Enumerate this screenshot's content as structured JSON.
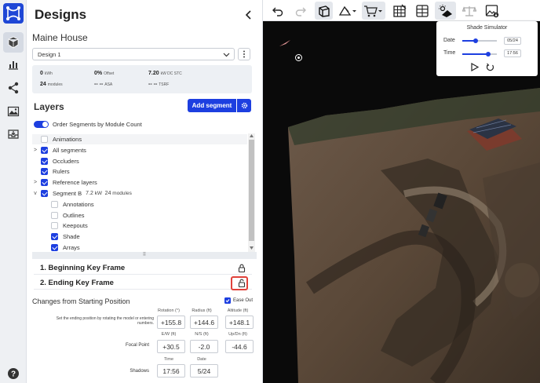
{
  "app": {
    "panel_title": "Designs"
  },
  "project": {
    "name": "Maine House",
    "design_selected": "Design 1"
  },
  "stats": {
    "energy_value": "0",
    "energy_unit": "kWh",
    "offset_value": "0%",
    "offset_unit": "Offset",
    "size_value": "7.20",
    "size_unit": "kW DC STC",
    "modules_value": "24",
    "modules_unit": "modules",
    "asa_value": "-- --",
    "asa_unit": "ASA",
    "tsrf_value": "-- --",
    "tsrf_unit": "TSRF"
  },
  "layers": {
    "heading": "Layers",
    "add_segment_label": "Add segment",
    "order_toggle_label": "Order Segments by Module Count",
    "order_toggle_on": true,
    "rows": [
      {
        "label": "Animations",
        "checked": false,
        "indent": 0,
        "twisty": ""
      },
      {
        "label": "All segments",
        "checked": true,
        "indent": 0,
        "twisty": ">"
      },
      {
        "label": "Occluders",
        "checked": true,
        "indent": 0,
        "twisty": ""
      },
      {
        "label": "Rulers",
        "checked": true,
        "indent": 0,
        "twisty": ""
      },
      {
        "label": "Reference layers",
        "checked": true,
        "indent": 0,
        "twisty": ">"
      },
      {
        "label": "Segment B",
        "checked": true,
        "indent": 0,
        "twisty": "v",
        "size": "7.2",
        "size_unit": "kW",
        "modules": "24",
        "modules_unit": "modules"
      },
      {
        "label": "Annotations",
        "checked": false,
        "indent": 1,
        "twisty": ""
      },
      {
        "label": "Outlines",
        "checked": false,
        "indent": 1,
        "twisty": ""
      },
      {
        "label": "Keepouts",
        "checked": false,
        "indent": 1,
        "twisty": ""
      },
      {
        "label": "Shade",
        "checked": true,
        "indent": 1,
        "twisty": ""
      },
      {
        "label": "Arrays",
        "checked": true,
        "indent": 1,
        "twisty": ""
      }
    ]
  },
  "keyframes": {
    "beginning": "1. Beginning Key Frame",
    "ending": "2. Ending Key Frame"
  },
  "changes": {
    "heading": "Changes from Starting Position",
    "ease_out_label": "Ease Out",
    "ease_out_checked": true,
    "hint": "Set the ending position by rotating the model or entering numbers.",
    "col_rotation": "Rotation (°)",
    "col_radius": "Radius (ft)",
    "col_altitude": "Altitude (ft)",
    "rotation": "+155.8",
    "radius": "+144.6",
    "altitude": "+148.1",
    "col_ew": "E/W (ft)",
    "col_ns": "N/S (ft)",
    "col_updn": "Up/Dn (ft)",
    "focal_label": "Focal Point",
    "ew": "+30.5",
    "ns": "-2.0",
    "updn": "-44.6",
    "col_time": "Time",
    "col_date": "Date",
    "shadows_label": "Shadows",
    "time": "17:56",
    "date": "5/24"
  },
  "shade_sim": {
    "title": "Shade Simulator",
    "date_label": "Date",
    "date_value": "05/24",
    "date_fraction": 0.39,
    "time_label": "Time",
    "time_value": "17:56",
    "time_fraction": 0.75
  },
  "colors": {
    "accent": "#1d3fe0",
    "highlight": "#e0413a",
    "rail_bg": "#eef0f3",
    "viewport_bg": "#0a0a0a"
  }
}
